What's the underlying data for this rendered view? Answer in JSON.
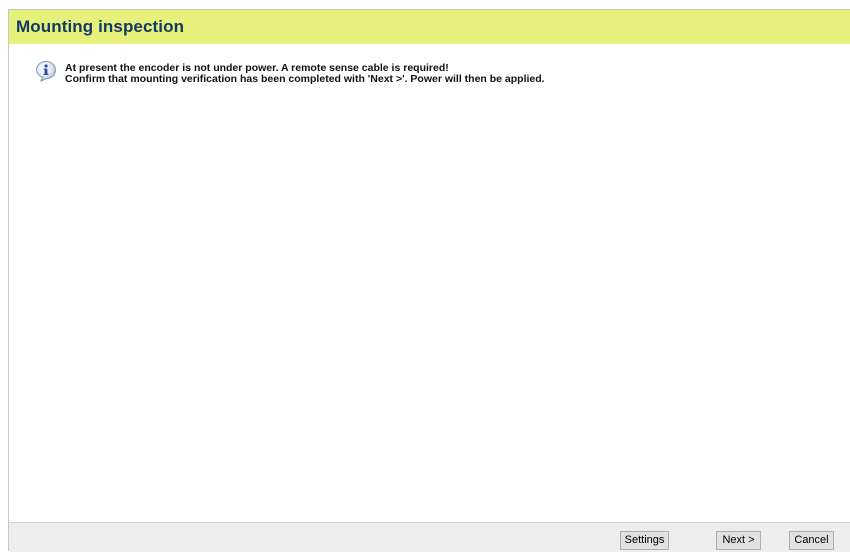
{
  "header": {
    "title": "Mounting inspection",
    "background_color": "#e6f07a",
    "title_color": "#123a66"
  },
  "message": {
    "icon": "info-icon",
    "line1": "At present the encoder is not under power. A remote sense cable is required!",
    "line2": "Confirm that mounting verification has been completed with 'Next >'. Power will then be applied."
  },
  "footer": {
    "settings_label": "Settings",
    "next_label": "Next >",
    "cancel_label": "Cancel"
  }
}
